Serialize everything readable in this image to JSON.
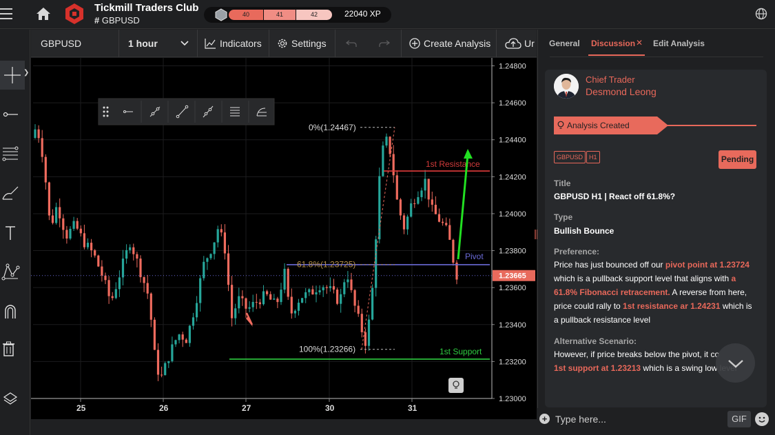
{
  "header": {
    "club_name": "Tickmill Traders Club",
    "channel": "GBPUSD",
    "levels": [
      "40",
      "41",
      "42"
    ],
    "xp": "22040 XP"
  },
  "toolbar": {
    "symbol": "GBPUSD",
    "interval": "1 hour",
    "indicators_label": "Indicators",
    "settings_label": "Settings",
    "create_label": "Create Analysis",
    "upload_label": "Ur"
  },
  "chart_data": {
    "type": "candlestick",
    "symbol": "GBPUSD",
    "interval": "1 hour",
    "x_tick_labels": [
      "25",
      "26",
      "27",
      "30",
      "31"
    ],
    "y_tick_labels": [
      "1.24800",
      "1.24600",
      "1.24400",
      "1.24200",
      "1.24000",
      "1.23800",
      "1.23600",
      "1.23400",
      "1.23200",
      "1.23000"
    ],
    "ylim": [
      1.23,
      1.248
    ],
    "current_price": "1.23665",
    "current_price_value": 1.23665,
    "grid": true,
    "annotations": {
      "fib_0": "0%(1.24467)",
      "fib_618": "61.8%(1.23725)",
      "fib_100": "100%(1.23266)",
      "resistance": "1st Resistance",
      "pivot": "Pivot",
      "support": "1st Support"
    },
    "levels": {
      "resistance": 1.24231,
      "pivot": 1.23724,
      "support": 1.23213,
      "fib_0": 1.24467,
      "fib_618": 1.23725,
      "fib_100": 1.23266
    }
  },
  "panel": {
    "tabs": [
      "General",
      "Discussion",
      "Edit Analysis"
    ],
    "author_role": "Chief Trader",
    "author_name": "Desmond Leong",
    "status": "Analysis Created",
    "tag_symbol": "GBPUSD",
    "tag_tf": "H1",
    "badge": "Pending",
    "title_label": "Title",
    "title_value": "GBPUSD H1 | React off 61.8%?",
    "type_label": "Type",
    "type_value": "Bullish Bounce",
    "preference_label": "Preference:",
    "pref_1": "Price has just bounced off our ",
    "pref_hl1": "pivot point at 1.23724",
    "pref_2": " which is a pullback support level that aligns with ",
    "pref_hl2": "a 61.8% Fibonacci retracement.",
    "pref_3": " A reverse from here, price could rally to ",
    "pref_hl3": "1st resistance ar 1.24231",
    "pref_4": " which is a pullback resistance level",
    "alt_label": "Alternative Scenario:",
    "alt_1": "However, if price breaks below the pivot, it co",
    "alt_hl1": "1st support at 1.23213",
    "alt_2": " which is a swing low level"
  },
  "composer": {
    "placeholder": "Type here...",
    "gif_label": "GIF"
  }
}
